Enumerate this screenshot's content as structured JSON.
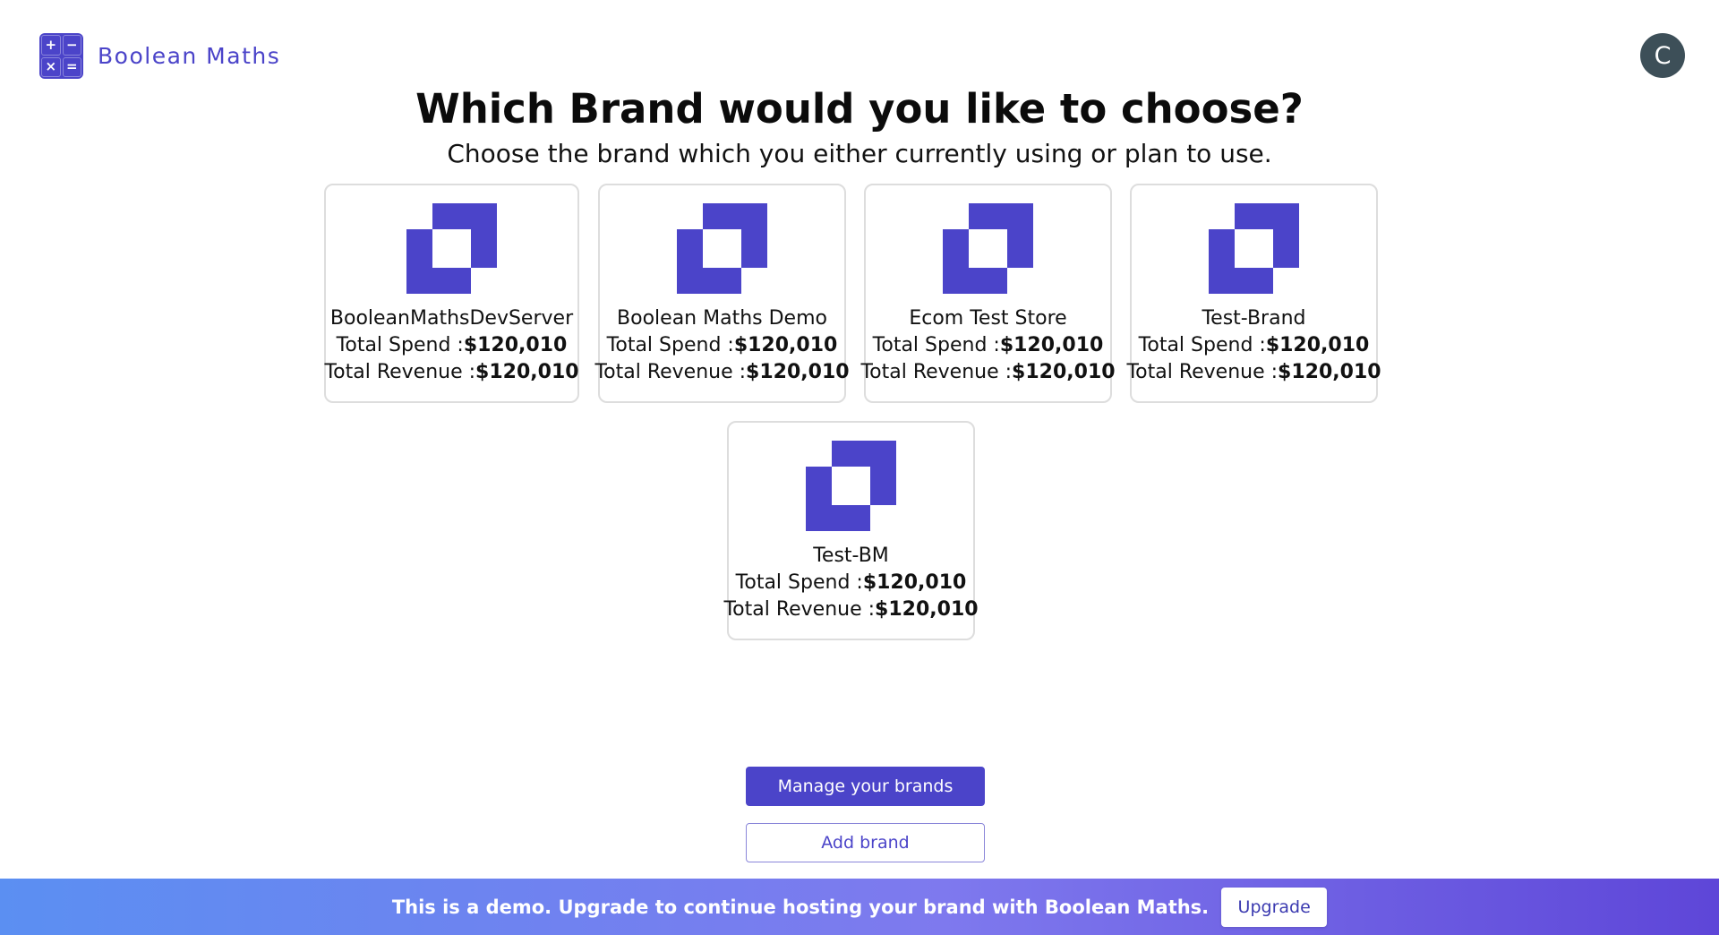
{
  "app": {
    "name": "Boolean Maths",
    "avatar_initial": "C",
    "brand_color": "#4b44c9"
  },
  "header": {
    "title": "Which Brand would you like to choose?",
    "subtitle": "Choose the brand which you either currently using or plan to use."
  },
  "brands": [
    {
      "name": "BooleanMathsDevServer",
      "spend_label": "Total Spend :",
      "spend": "$120,010",
      "revenue_label": "Total Revenue :",
      "revenue": "$120,010"
    },
    {
      "name": "Boolean Maths Demo",
      "spend_label": "Total Spend :",
      "spend": "$120,010",
      "revenue_label": "Total Revenue :",
      "revenue": "$120,010"
    },
    {
      "name": "Ecom Test Store",
      "spend_label": "Total Spend :",
      "spend": "$120,010",
      "revenue_label": "Total Revenue :",
      "revenue": "$120,010"
    },
    {
      "name": "Test-Brand",
      "spend_label": "Total Spend :",
      "spend": "$120,010",
      "revenue_label": "Total Revenue :",
      "revenue": "$120,010"
    },
    {
      "name": "Test-BM",
      "spend_label": "Total Spend :",
      "spend": "$120,010",
      "revenue_label": "Total Revenue :",
      "revenue": "$120,010"
    }
  ],
  "actions": {
    "manage_label": "Manage your brands",
    "add_label": "Add brand"
  },
  "banner": {
    "text": "This is a demo. Upgrade to continue hosting your brand with Boolean Maths.",
    "upgrade_label": "Upgrade"
  }
}
